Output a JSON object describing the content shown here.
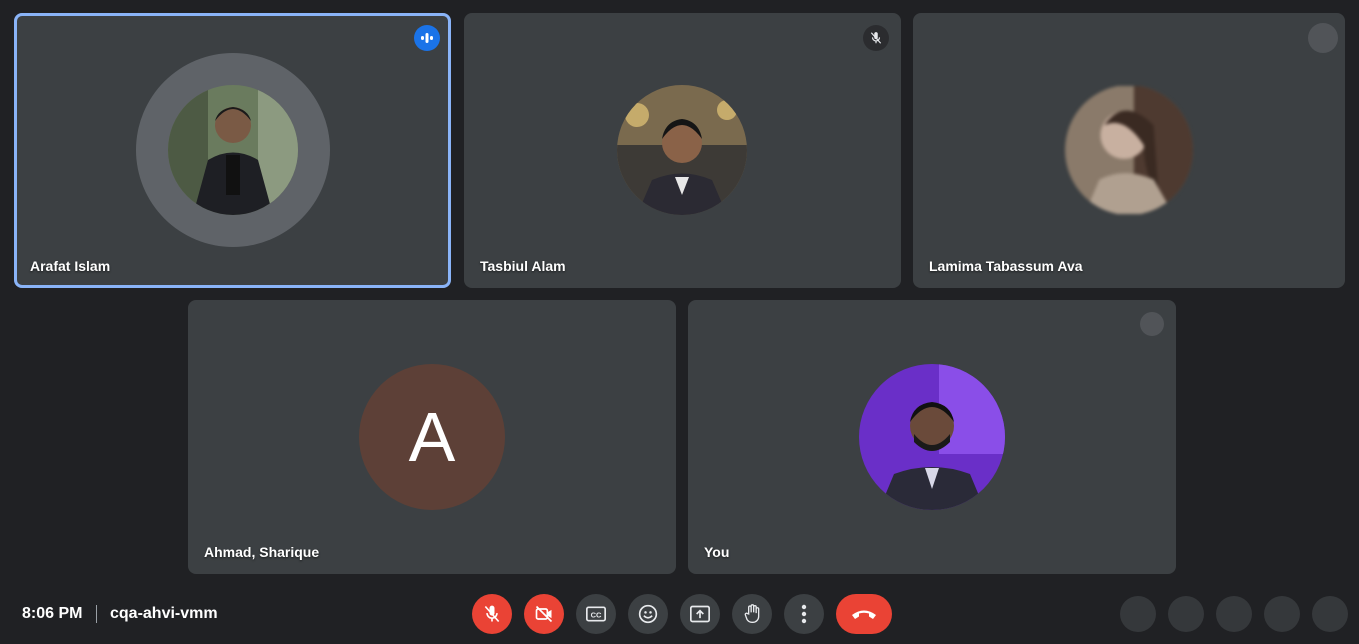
{
  "participants": [
    {
      "name": "Arafat Islam",
      "status": "speaking"
    },
    {
      "name": "Tasbiul Alam",
      "status": "muted"
    },
    {
      "name": "Lamima Tabassum Ava",
      "status": "unknown"
    },
    {
      "name": "Ahmad, Sharique",
      "initial": "A",
      "avatar_color": "#5d4037"
    },
    {
      "name": "You",
      "status": "unknown"
    }
  ],
  "bottom_bar": {
    "time": "8:06 PM",
    "meeting_code": "cqa-ahvi-vmm"
  },
  "controls": {
    "mic": "mic-off-icon",
    "camera": "camera-off-icon",
    "captions": "CC",
    "reactions": "emoji-icon",
    "present": "present-icon",
    "raise_hand": "hand-icon",
    "more": "more-vert-icon",
    "leave": "end-call-icon"
  },
  "colors": {
    "background": "#202124",
    "tile": "#3c4043",
    "speaking_border": "#8ab4f8",
    "danger": "#ea4335",
    "speaking_badge": "#1a73e8"
  }
}
